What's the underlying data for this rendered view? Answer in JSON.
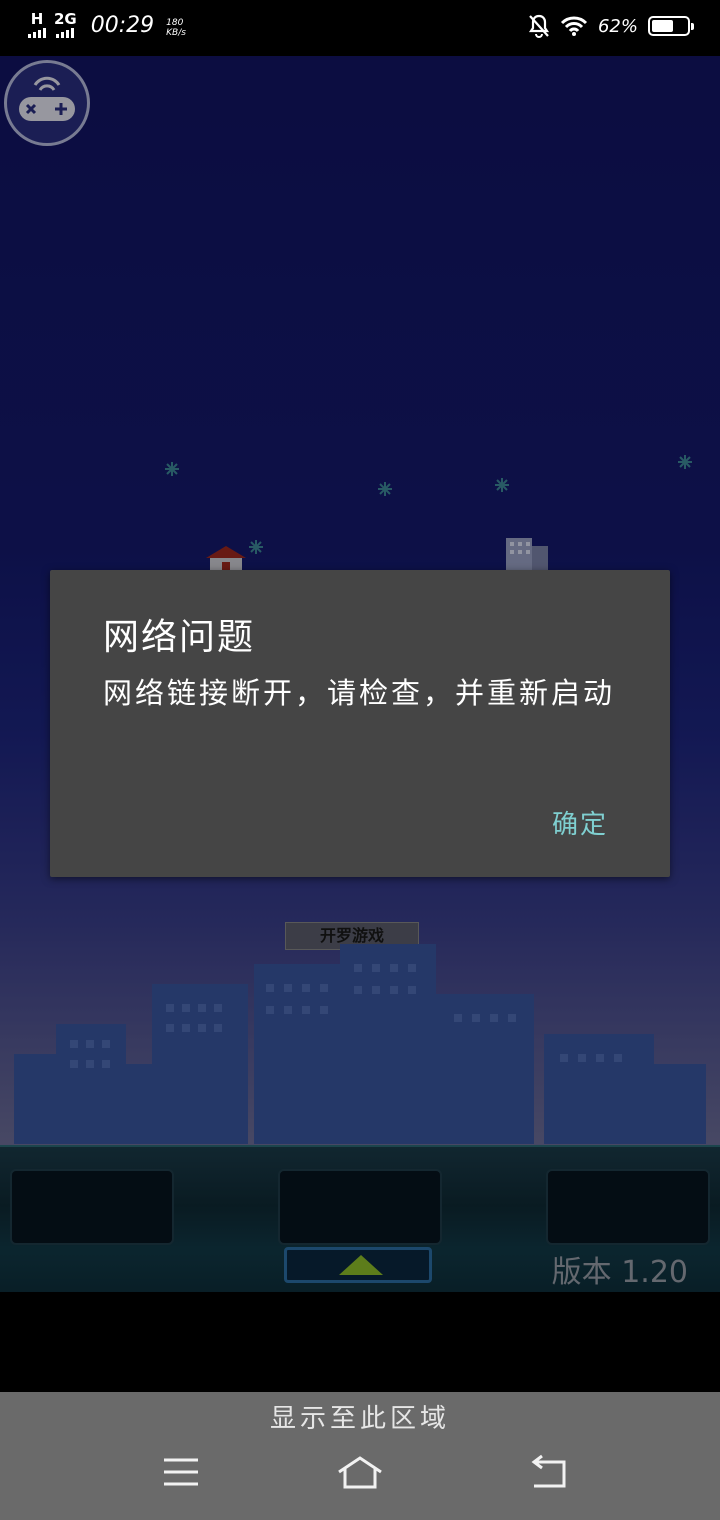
{
  "status_bar": {
    "network_type": "H",
    "network_type_2": "2G",
    "time": "00:29",
    "speed_value": "180",
    "speed_unit": "KB/s",
    "battery_percent": "62%",
    "battery_level": 0.62
  },
  "game": {
    "logo_sign": "开罗游戏",
    "version_label": "版本 1.20"
  },
  "dialog": {
    "title": "网络问题",
    "message": "网络链接断开，请检查，并重新启动",
    "ok_label": "确定"
  },
  "bottom_hint": {
    "text": "显示至此区域"
  },
  "nav_bar": {
    "menu_icon": "menu-icon",
    "home_icon": "home-icon",
    "back_icon": "back-icon"
  },
  "colors": {
    "dialog_bg": "#454545",
    "dialog_accent": "#7fcfd0",
    "sky_top": "#131464"
  }
}
